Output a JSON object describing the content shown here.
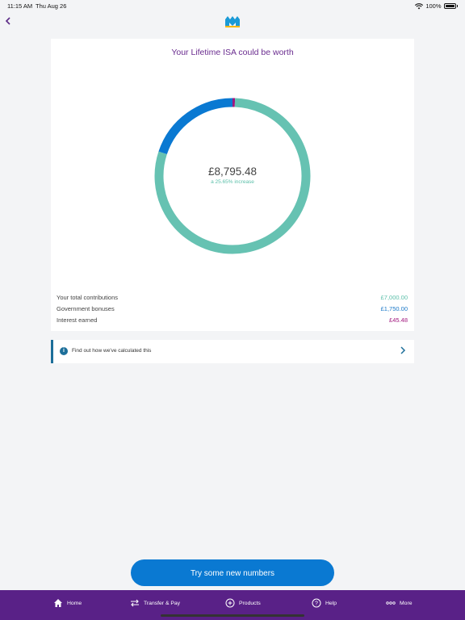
{
  "status_bar": {
    "time": "11:15 AM",
    "date": "Thu Aug 26",
    "battery": "100%"
  },
  "nav": {
    "back_icon": "chevron-left-icon",
    "logo_icon": "brand-logo-icon"
  },
  "card": {
    "title": "Your Lifetime ISA could be worth",
    "total_value": "£8,795.48",
    "increase_text": "a 25.65% increase",
    "rows": [
      {
        "label": "Your total contributions",
        "value": "£7,000.00",
        "color": "#5bbfa9"
      },
      {
        "label": "Government bonuses",
        "value": "£1,750.00",
        "color": "#1a78c8"
      },
      {
        "label": "Interest earned",
        "value": "£45.48",
        "color": "#a1177e"
      }
    ]
  },
  "chart_data": {
    "type": "pie",
    "categories": [
      "Your total contributions",
      "Government bonuses",
      "Interest earned"
    ],
    "values": [
      7000.0,
      1750.0,
      45.48
    ],
    "colors": [
      "#66c2b2",
      "#0a79d2",
      "#a1177e"
    ],
    "style": "donut",
    "title": "Your Lifetime ISA could be worth",
    "center_label": "£8,795.48",
    "center_sublabel": "a 25.65% increase"
  },
  "info_bar": {
    "text": "Find out how we've calculated this",
    "icon": "info-icon",
    "chevron": "chevron-right-icon"
  },
  "cta": {
    "label": "Try some new numbers"
  },
  "tabbar": {
    "items": [
      {
        "label": "Home",
        "icon": "home-icon"
      },
      {
        "label": "Transfer & Pay",
        "icon": "transfer-icon"
      },
      {
        "label": "Products",
        "icon": "plus-circle-icon"
      },
      {
        "label": "Help",
        "icon": "help-icon"
      },
      {
        "label": "More",
        "icon": "more-icon"
      }
    ]
  },
  "colors": {
    "brand_purple": "#592187",
    "accent_blue": "#0a79d2",
    "teal": "#5bbfa9",
    "magenta": "#a1177e"
  }
}
